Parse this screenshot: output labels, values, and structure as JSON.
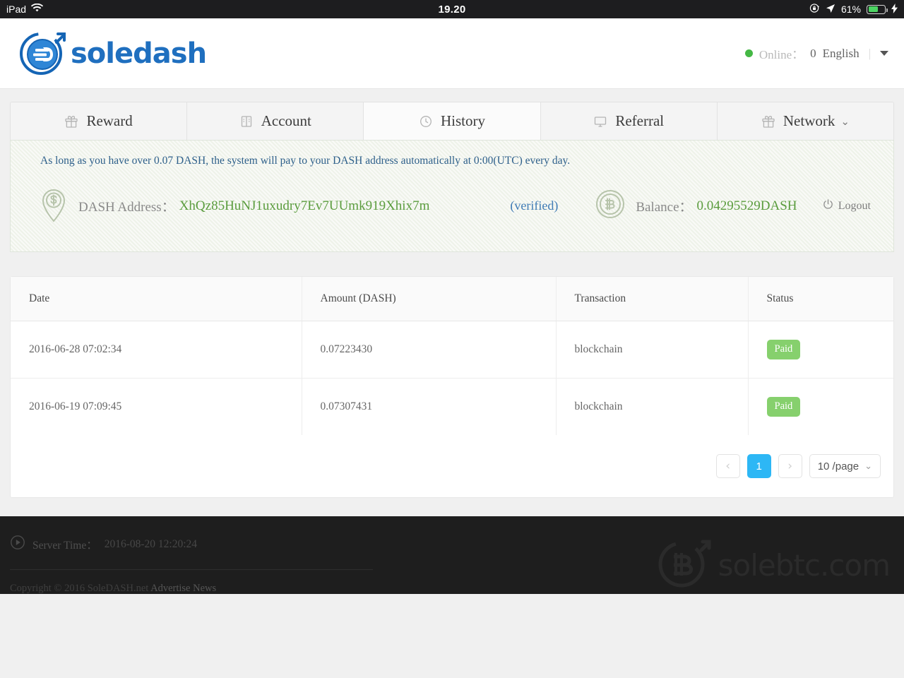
{
  "statusbar": {
    "device": "iPad",
    "wifi_icon": "wifi-icon",
    "time": "19.20",
    "rotation_lock_icon": "rotation-lock-icon",
    "location_icon": "location-arrow-icon",
    "battery_percent": "61%",
    "battery_level": 61,
    "charging_icon": "lightning-bolt-icon"
  },
  "header": {
    "logo_icon": "soledash-coin-logo",
    "logo_text": "soledash",
    "online_label": "Online：",
    "online_count": "0",
    "language": "English",
    "separator": "|",
    "caret_icon": "chevron-down-icon",
    "brand_color": "#1f6fbf",
    "online_dot_color": "#45b845"
  },
  "tabs": [
    {
      "label": "Reward",
      "icon": "gift-icon",
      "active": false
    },
    {
      "label": "Account",
      "icon": "book-icon",
      "active": false
    },
    {
      "label": "History",
      "icon": "clock-icon",
      "active": true
    },
    {
      "label": "Referral",
      "icon": "monitor-icon",
      "active": false
    },
    {
      "label": "Network",
      "icon": "gift-icon",
      "active": false,
      "caret": "⌄"
    }
  ],
  "panel": {
    "notice": "As long as you have over 0.07 DASH, the system will pay to your DASH address automatically at 0:00(UTC) every day.",
    "address_icon": "dollar-pin-icon",
    "address_label": "DASH Address：",
    "address_value": "XhQz85HuNJ1uxudry7Ev7UUmk919Xhix7m",
    "verified_text": "(verified)",
    "balance_icon": "bitcoin-circle-icon",
    "balance_label": "Balance：",
    "balance_value": "0.04295529DASH",
    "logout_icon": "power-icon",
    "logout_label": "Logout",
    "value_color": "#5a9c3d",
    "notice_color": "#2d5f8a"
  },
  "table": {
    "columns": [
      "Date",
      "Amount (DASH)",
      "Transaction",
      "Status"
    ],
    "rows": [
      {
        "date": "2016-06-28 07:02:34",
        "amount": "0.07223430",
        "transaction": "blockchain",
        "status": "Paid"
      },
      {
        "date": "2016-06-19 07:09:45",
        "amount": "0.07307431",
        "transaction": "blockchain",
        "status": "Paid"
      }
    ],
    "status_color": "#86d06d"
  },
  "pagination": {
    "prev_icon": "chevron-left-icon",
    "next_icon": "chevron-right-icon",
    "current_page": "1",
    "page_size": "10 /page",
    "page_size_caret": "⌄",
    "active_color": "#2db7f5"
  },
  "footer": {
    "server_time_icon": "play-circle-icon",
    "server_time_label": "Server Time：",
    "server_time_value": "2016-08-20 12:20:24",
    "copyright": "Copyright © 2016 SoleDASH.net",
    "advertise_link": "Advertise",
    "news_link": "News",
    "watermark_icon": "bitcoin-circle-logo",
    "watermark_text": "solebtc.com"
  }
}
